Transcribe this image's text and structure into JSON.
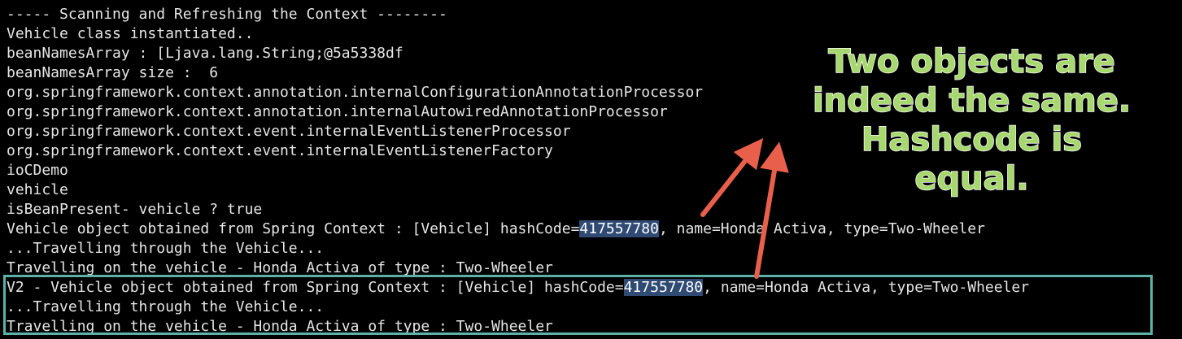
{
  "console": {
    "lines": [
      {
        "id": "header",
        "text": "----- Scanning and Refreshing the Context --------"
      },
      {
        "id": "vehicle-instantiated",
        "text": "Vehicle class instantiated.."
      },
      {
        "id": "bean-names-array",
        "text": "beanNamesArray : [Ljava.lang.String;@5a5338df"
      },
      {
        "id": "bean-names-size",
        "text": "beanNamesArray size :  6"
      },
      {
        "id": "bean-config-processor",
        "text": "org.springframework.context.annotation.internalConfigurationAnnotationProcessor"
      },
      {
        "id": "bean-autowired-processor",
        "text": "org.springframework.context.annotation.internalAutowiredAnnotationProcessor"
      },
      {
        "id": "bean-event-listener-processor",
        "text": "org.springframework.context.event.internalEventListenerProcessor"
      },
      {
        "id": "bean-event-listener-factory",
        "text": "org.springframework.context.event.internalEventListenerFactory"
      },
      {
        "id": "bean-iocdemo",
        "text": "ioCDemo"
      },
      {
        "id": "bean-vehicle",
        "text": "vehicle"
      },
      {
        "id": "is-bean-present",
        "text": "isBeanPresent- vehicle ? true"
      }
    ],
    "v1_object_line": {
      "prefix": "Vehicle object obtained from Spring Context : [Vehicle] hashCode=",
      "hash": "417557780",
      "suffix": ", name=Honda Activa, type=Two-Wheeler"
    },
    "v1_travelling": "...Travelling through the Vehicle...",
    "v1_travelling_on": "Travelling on the vehicle - Honda Activa of type : Two-Wheeler",
    "v2_object_line": {
      "prefix": "V2 - Vehicle object obtained from Spring Context : [Vehicle] hashCode=",
      "hash": "417557780",
      "suffix": ", name=Honda Activa, type=Two-Wheeler"
    },
    "v2_travelling": "...Travelling through the Vehicle...",
    "v2_travelling_on": "Travelling on the vehicle - Honda Activa of type : Two-Wheeler"
  },
  "callout": {
    "lines": [
      "Two objects are",
      "indeed the same.",
      "Hashcode is equal."
    ]
  },
  "colors": {
    "background": "#000000",
    "text": "#e6e6e6",
    "hash_highlight": "#2f4a73",
    "callout_text": "#a6d86e",
    "arrow": "#e8604c",
    "box_border": "#5bb3a8"
  }
}
